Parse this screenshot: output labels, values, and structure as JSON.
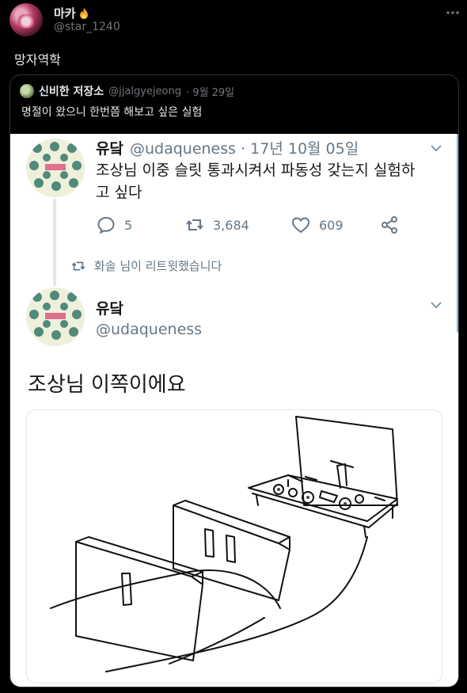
{
  "outer_tweet": {
    "display_name": "마카",
    "handle": "@star_1240",
    "text": "망자역학"
  },
  "quoted_tweet": {
    "name": "신비한 저장소",
    "handle": "@jjalgyejeong",
    "date": "· 9월 29일",
    "text": "명절이 왔으니 한번쯤 해보고 싶은 실험"
  },
  "embedded": {
    "tweet1": {
      "name": "유닼",
      "meta": "@udaqueness · 17년 10월 05일",
      "text": "조상님 이중 슬릿 통과시켜서 파동성 갖는지 실험하고 싶다",
      "reply_count": "5",
      "retweet_count": "3,684",
      "like_count": "609"
    },
    "retweet_note": "화솔 님이 리트윗했습니다",
    "tweet2": {
      "name": "유닼",
      "handle": "@udaqueness",
      "text": "조상님 이쪽이에요"
    }
  },
  "icons": {
    "fire": "fire-icon",
    "more": "more-horizontal-icon",
    "reply": "reply-icon",
    "retweet": "retweet-icon",
    "like": "heart-icon",
    "share": "share-icon",
    "chevron": "chevron-down-icon"
  },
  "colors": {
    "background": "#000000",
    "text_primary": "#e7e9ea",
    "text_secondary": "#71767b",
    "embedded_accent": "#7fb2e5"
  }
}
